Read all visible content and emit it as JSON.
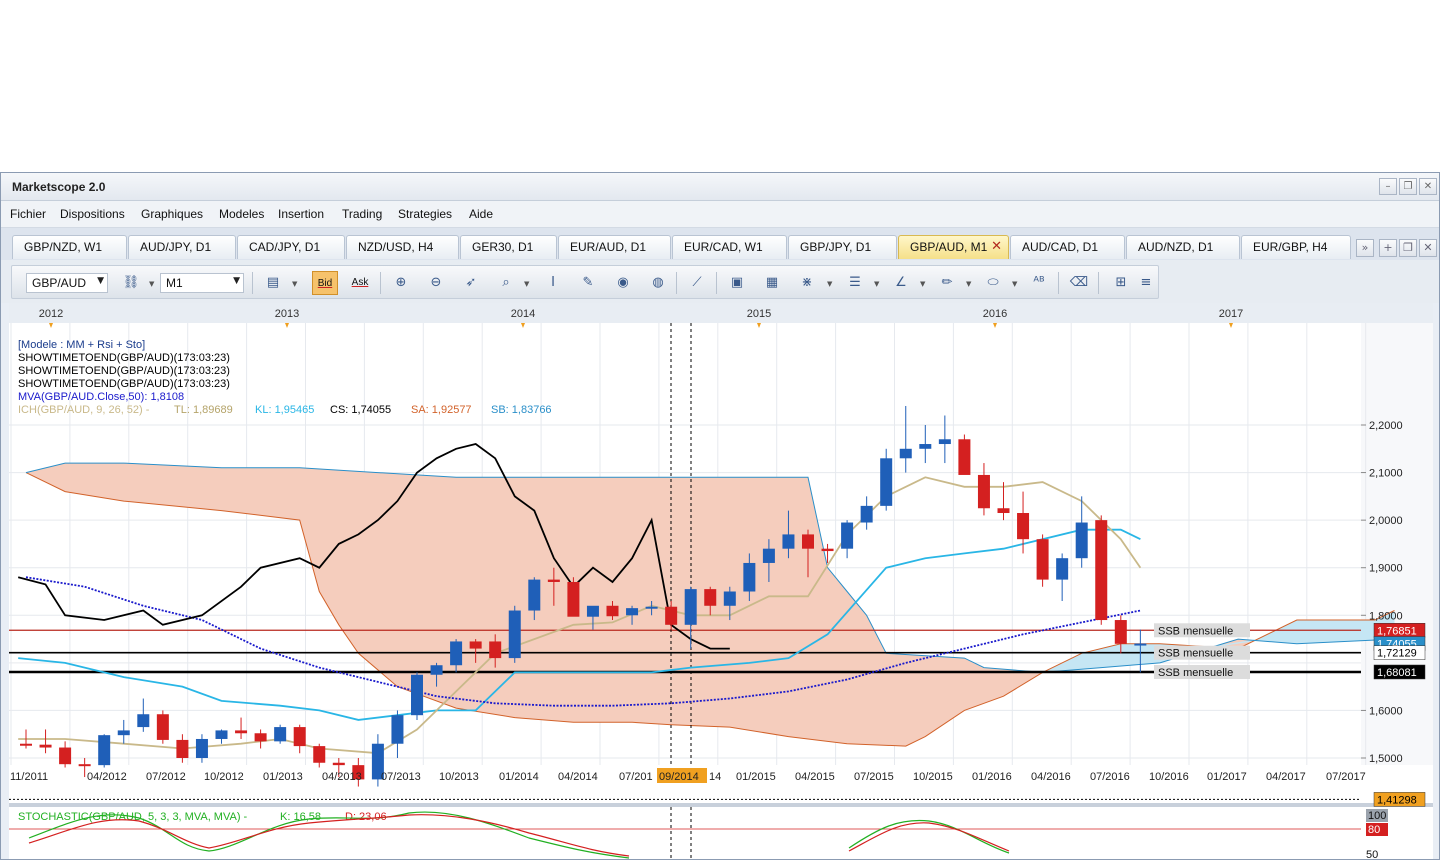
{
  "window": {
    "title": "Marketscope 2.0",
    "controls": [
      "–",
      "❐",
      "✕"
    ]
  },
  "menu": [
    "Fichier",
    "Dispositions",
    "Graphiques",
    "Modeles",
    "Insertion",
    "Trading",
    "Strategies",
    "Aide"
  ],
  "tabs": [
    {
      "label": "GBP/NZD, W1",
      "active": false
    },
    {
      "label": "AUD/JPY, D1",
      "active": false
    },
    {
      "label": "CAD/JPY, D1",
      "active": false
    },
    {
      "label": "NZD/USD, H4",
      "active": false
    },
    {
      "label": "GER30, D1",
      "active": false
    },
    {
      "label": "EUR/AUD, D1",
      "active": false
    },
    {
      "label": "EUR/CAD, W1",
      "active": false
    },
    {
      "label": "GBP/JPY, D1",
      "active": false
    },
    {
      "label": "GBP/AUD, M1",
      "active": true
    },
    {
      "label": "AUD/CAD, D1",
      "active": false
    },
    {
      "label": "AUD/NZD, D1",
      "active": false
    },
    {
      "label": "EUR/GBP, H4",
      "active": false
    }
  ],
  "tab_close_glyph": "✕",
  "tab_controls": [
    "»",
    "+",
    "❐",
    "✕"
  ],
  "toolbar": {
    "instrument": "GBP/AUD",
    "timeframe": "M1",
    "bid_label": "Bid",
    "ask_label": "Ask",
    "icons": [
      "link-icon",
      "chart-type-icon",
      "zoom-in-icon",
      "zoom-out-icon",
      "cursor-icon",
      "data-window-icon",
      "indicator-icon",
      "template-icon",
      "eye-icon",
      "globe-icon",
      "ruler-icon",
      "picture-icon",
      "window-icon",
      "fibonacci-icon",
      "lines-icon",
      "trendline-icon",
      "pencil-icon",
      "ellipse-icon",
      "text-icon",
      "eraser-icon",
      "tree-icon",
      "more-icon"
    ]
  },
  "chart_data": {
    "type": "candlestick",
    "title": "",
    "top_years": [
      "2012",
      "2013",
      "2014",
      "2015",
      "2016",
      "2017"
    ],
    "x_labels": [
      "11/2011",
      "04/2012",
      "07/2012",
      "10/2012",
      "01/2013",
      "04/2013",
      "07/2013",
      "10/2013",
      "01/2014",
      "04/2014",
      "07/201",
      "09/2014",
      "14",
      "01/2015",
      "04/2015",
      "07/2015",
      "10/2015",
      "01/2016",
      "04/2016",
      "07/2016",
      "10/2016",
      "01/2017",
      "04/2017",
      "07/2017"
    ],
    "cursor_x_label": "09/2014",
    "y_ticks": [
      "2,2000",
      "2,1000",
      "2,0000",
      "1,9000",
      "1,8000",
      "1,6000",
      "1,5000"
    ],
    "ylim": [
      1.41,
      2.32
    ],
    "legend_lines": [
      {
        "text": "[Modele : MM + Rsi + Sto]",
        "color": "#1a3c8c"
      },
      {
        "text": "SHOWTIMETOEND(GBP/AUD)(173:03:23)",
        "color": "#000000"
      },
      {
        "text": "SHOWTIMETOEND(GBP/AUD)(173:03:23)",
        "color": "#000000"
      },
      {
        "text": "SHOWTIMETOEND(GBP/AUD)(173:03:23)",
        "color": "#000000"
      },
      {
        "text": "MVA(GBP/AUD.Close,50): 1,8108",
        "color": "#1a1acc"
      }
    ],
    "ichimoku_legend": [
      {
        "text": "ICH(GBP/AUD, 9, 26, 52) -",
        "color": "#c9b98a"
      },
      {
        "text": "TL: 1,89689",
        "color": "#b5a46a"
      },
      {
        "text": "KL: 1,95465",
        "color": "#29b6e6"
      },
      {
        "text": "CS: 1,74055",
        "color": "#000000"
      },
      {
        "text": "SA: 1,92577",
        "color": "#d2622a"
      },
      {
        "text": "SB: 1,83766",
        "color": "#2a8fc9"
      }
    ],
    "price_labels": [
      {
        "text": "1,76851",
        "value": 1.7685,
        "bg": "#d42020",
        "fg": "#ffffff"
      },
      {
        "text": "1,74055",
        "value": 1.7406,
        "bg": "#2a8fc9",
        "fg": "#ffffff"
      },
      {
        "text": "1,72129",
        "value": 1.7213,
        "bg": "#ffffff",
        "fg": "#000000"
      },
      {
        "text": "1,68081",
        "value": 1.6808,
        "bg": "#000000",
        "fg": "#ffffff"
      },
      {
        "text": "1,41298",
        "value": 1.413,
        "bg": "#f0a020",
        "fg": "#000000"
      }
    ],
    "ssb_labels": [
      {
        "text": "SSB mensuelle",
        "value": 1.7685
      },
      {
        "text": "SSB mensuelle",
        "value": 1.7213
      },
      {
        "text": "SSB mensuelle",
        "value": 1.6808
      }
    ],
    "candles": [
      {
        "o": 1.53,
        "h": 1.56,
        "l": 1.52,
        "c": 1.528
      },
      {
        "o": 1.528,
        "h": 1.56,
        "l": 1.51,
        "c": 1.522
      },
      {
        "o": 1.522,
        "h": 1.535,
        "l": 1.48,
        "c": 1.487
      },
      {
        "o": 1.487,
        "h": 1.5,
        "l": 1.46,
        "c": 1.484
      },
      {
        "o": 1.485,
        "h": 1.55,
        "l": 1.48,
        "c": 1.548
      },
      {
        "o": 1.548,
        "h": 1.58,
        "l": 1.53,
        "c": 1.558
      },
      {
        "o": 1.565,
        "h": 1.625,
        "l": 1.555,
        "c": 1.592
      },
      {
        "o": 1.592,
        "h": 1.6,
        "l": 1.53,
        "c": 1.538
      },
      {
        "o": 1.538,
        "h": 1.55,
        "l": 1.49,
        "c": 1.5
      },
      {
        "o": 1.5,
        "h": 1.55,
        "l": 1.49,
        "c": 1.54
      },
      {
        "o": 1.54,
        "h": 1.56,
        "l": 1.53,
        "c": 1.558
      },
      {
        "o": 1.558,
        "h": 1.585,
        "l": 1.54,
        "c": 1.552
      },
      {
        "o": 1.552,
        "h": 1.56,
        "l": 1.52,
        "c": 1.535
      },
      {
        "o": 1.535,
        "h": 1.57,
        "l": 1.53,
        "c": 1.565
      },
      {
        "o": 1.565,
        "h": 1.57,
        "l": 1.51,
        "c": 1.525
      },
      {
        "o": 1.525,
        "h": 1.53,
        "l": 1.48,
        "c": 1.49
      },
      {
        "o": 1.49,
        "h": 1.5,
        "l": 1.46,
        "c": 1.485
      },
      {
        "o": 1.485,
        "h": 1.5,
        "l": 1.44,
        "c": 1.455
      },
      {
        "o": 1.455,
        "h": 1.55,
        "l": 1.44,
        "c": 1.53
      },
      {
        "o": 1.53,
        "h": 1.6,
        "l": 1.5,
        "c": 1.59
      },
      {
        "o": 1.59,
        "h": 1.68,
        "l": 1.58,
        "c": 1.675
      },
      {
        "o": 1.675,
        "h": 1.7,
        "l": 1.65,
        "c": 1.695
      },
      {
        "o": 1.695,
        "h": 1.75,
        "l": 1.68,
        "c": 1.745
      },
      {
        "o": 1.745,
        "h": 1.75,
        "l": 1.7,
        "c": 1.73
      },
      {
        "o": 1.745,
        "h": 1.76,
        "l": 1.69,
        "c": 1.71
      },
      {
        "o": 1.71,
        "h": 1.82,
        "l": 1.7,
        "c": 1.81
      },
      {
        "o": 1.81,
        "h": 1.88,
        "l": 1.79,
        "c": 1.875
      },
      {
        "o": 1.875,
        "h": 1.9,
        "l": 1.82,
        "c": 1.87
      },
      {
        "o": 1.87,
        "h": 1.88,
        "l": 1.8,
        "c": 1.797
      },
      {
        "o": 1.797,
        "h": 1.81,
        "l": 1.77,
        "c": 1.82
      },
      {
        "o": 1.82,
        "h": 1.83,
        "l": 1.79,
        "c": 1.798
      },
      {
        "o": 1.8,
        "h": 1.82,
        "l": 1.78,
        "c": 1.815
      },
      {
        "o": 1.815,
        "h": 1.83,
        "l": 1.8,
        "c": 1.818
      },
      {
        "o": 1.818,
        "h": 1.83,
        "l": 1.77,
        "c": 1.78
      },
      {
        "o": 1.78,
        "h": 1.86,
        "l": 1.73,
        "c": 1.855
      },
      {
        "o": 1.855,
        "h": 1.86,
        "l": 1.8,
        "c": 1.82
      },
      {
        "o": 1.82,
        "h": 1.86,
        "l": 1.79,
        "c": 1.85
      },
      {
        "o": 1.85,
        "h": 1.93,
        "l": 1.83,
        "c": 1.91
      },
      {
        "o": 1.91,
        "h": 1.96,
        "l": 1.87,
        "c": 1.94
      },
      {
        "o": 1.94,
        "h": 2.02,
        "l": 1.92,
        "c": 1.97
      },
      {
        "o": 1.97,
        "h": 1.98,
        "l": 1.88,
        "c": 1.94
      },
      {
        "o": 1.94,
        "h": 1.95,
        "l": 1.91,
        "c": 1.935
      },
      {
        "o": 1.94,
        "h": 2.0,
        "l": 1.92,
        "c": 1.995
      },
      {
        "o": 1.995,
        "h": 2.05,
        "l": 1.98,
        "c": 2.03
      },
      {
        "o": 2.03,
        "h": 2.15,
        "l": 2.02,
        "c": 2.13
      },
      {
        "o": 2.13,
        "h": 2.24,
        "l": 2.1,
        "c": 2.15
      },
      {
        "o": 2.15,
        "h": 2.2,
        "l": 2.12,
        "c": 2.16
      },
      {
        "o": 2.16,
        "h": 2.22,
        "l": 2.12,
        "c": 2.17
      },
      {
        "o": 2.17,
        "h": 2.18,
        "l": 2.1,
        "c": 2.095
      },
      {
        "o": 2.095,
        "h": 2.12,
        "l": 2.01,
        "c": 2.025
      },
      {
        "o": 2.025,
        "h": 2.08,
        "l": 2.0,
        "c": 2.015
      },
      {
        "o": 2.015,
        "h": 2.06,
        "l": 1.93,
        "c": 1.96
      },
      {
        "o": 1.96,
        "h": 1.97,
        "l": 1.86,
        "c": 1.875
      },
      {
        "o": 1.875,
        "h": 1.93,
        "l": 1.83,
        "c": 1.92
      },
      {
        "o": 1.92,
        "h": 2.05,
        "l": 1.9,
        "c": 1.995
      },
      {
        "o": 2.0,
        "h": 2.01,
        "l": 1.78,
        "c": 1.79
      },
      {
        "o": 1.79,
        "h": 1.8,
        "l": 1.72,
        "c": 1.74
      },
      {
        "o": 1.74,
        "h": 1.77,
        "l": 1.68,
        "c": 1.7406
      }
    ],
    "mva50": [
      [
        0,
        1.88
      ],
      [
        3,
        1.86
      ],
      [
        6,
        1.82
      ],
      [
        9,
        1.79
      ],
      [
        12,
        1.73
      ],
      [
        15,
        1.69
      ],
      [
        18,
        1.66
      ],
      [
        21,
        1.63
      ],
      [
        24,
        1.615
      ],
      [
        27,
        1.61
      ],
      [
        30,
        1.61
      ],
      [
        33,
        1.615
      ],
      [
        36,
        1.625
      ],
      [
        39,
        1.64
      ],
      [
        42,
        1.665
      ],
      [
        45,
        1.7
      ],
      [
        48,
        1.73
      ],
      [
        51,
        1.76
      ],
      [
        54,
        1.785
      ],
      [
        57,
        1.81
      ]
    ],
    "chikou": [
      [
        -0.4,
        1.88
      ],
      [
        1,
        1.865
      ],
      [
        2,
        1.8
      ],
      [
        4,
        1.79
      ],
      [
        6,
        1.81
      ],
      [
        7,
        1.78
      ],
      [
        9,
        1.8
      ],
      [
        11,
        1.86
      ],
      [
        12,
        1.9
      ],
      [
        14,
        1.92
      ],
      [
        15,
        1.9
      ],
      [
        16,
        1.95
      ],
      [
        17,
        1.97
      ],
      [
        18,
        2.0
      ],
      [
        19,
        2.04
      ],
      [
        20,
        2.1
      ],
      [
        21,
        2.13
      ],
      [
        22,
        2.15
      ],
      [
        23,
        2.16
      ],
      [
        24,
        2.13
      ],
      [
        25,
        2.05
      ],
      [
        26,
        2.02
      ],
      [
        27,
        1.92
      ],
      [
        28,
        1.86
      ],
      [
        29,
        1.9
      ],
      [
        30,
        1.87
      ],
      [
        31,
        1.92
      ],
      [
        32,
        2.0
      ],
      [
        33,
        1.78
      ],
      [
        34,
        1.75
      ],
      [
        35,
        1.73
      ],
      [
        36,
        1.73
      ]
    ],
    "senkou_a": [
      [
        0,
        2.1
      ],
      [
        2,
        2.06
      ],
      [
        5,
        2.04
      ],
      [
        10,
        2.02
      ],
      [
        14,
        2.0
      ],
      [
        15,
        1.85
      ],
      [
        16,
        1.78
      ],
      [
        17,
        1.72
      ],
      [
        19,
        1.65
      ],
      [
        22,
        1.605
      ],
      [
        25,
        1.585
      ],
      [
        28,
        1.575
      ],
      [
        31,
        1.575
      ],
      [
        33,
        1.57
      ],
      [
        36,
        1.565
      ],
      [
        39,
        1.545
      ],
      [
        42,
        1.53
      ],
      [
        45,
        1.525
      ],
      [
        46,
        1.545
      ],
      [
        48,
        1.6
      ],
      [
        50,
        1.63
      ],
      [
        52,
        1.68
      ],
      [
        54,
        1.72
      ],
      [
        56,
        1.74
      ],
      [
        58,
        1.74
      ],
      [
        62,
        1.73
      ],
      [
        65,
        1.79
      ],
      [
        69,
        1.79
      ],
      [
        70,
        1.81
      ]
    ],
    "senkou_b": [
      [
        0,
        2.1
      ],
      [
        2,
        2.12
      ],
      [
        5,
        2.12
      ],
      [
        10,
        2.11
      ],
      [
        14,
        2.11
      ],
      [
        18,
        2.1
      ],
      [
        22,
        2.09
      ],
      [
        26,
        2.09
      ],
      [
        30,
        2.09
      ],
      [
        34,
        2.09
      ],
      [
        38,
        2.09
      ],
      [
        40,
        2.09
      ],
      [
        41,
        1.9
      ],
      [
        42,
        1.85
      ],
      [
        43,
        1.8
      ],
      [
        44,
        1.72
      ],
      [
        48,
        1.71
      ],
      [
        49,
        1.69
      ],
      [
        52,
        1.68
      ],
      [
        55,
        1.69
      ],
      [
        58,
        1.7
      ],
      [
        62,
        1.75
      ],
      [
        65,
        1.74
      ],
      [
        70,
        1.75
      ]
    ],
    "kijun": [
      [
        -0.4,
        1.71
      ],
      [
        2,
        1.7
      ],
      [
        5,
        1.67
      ],
      [
        8,
        1.65
      ],
      [
        10,
        1.62
      ],
      [
        13,
        1.61
      ],
      [
        15,
        1.6
      ],
      [
        17,
        1.58
      ],
      [
        19,
        1.59
      ],
      [
        21,
        1.6
      ],
      [
        23,
        1.6
      ],
      [
        25,
        1.68
      ],
      [
        28,
        1.68
      ],
      [
        30,
        1.68
      ],
      [
        32,
        1.68
      ],
      [
        34,
        1.69
      ],
      [
        37,
        1.7
      ],
      [
        39,
        1.71
      ],
      [
        41,
        1.76
      ],
      [
        44,
        1.9
      ],
      [
        46,
        1.92
      ],
      [
        48,
        1.93
      ],
      [
        50,
        1.94
      ],
      [
        54,
        1.98
      ],
      [
        56,
        1.98
      ],
      [
        57,
        1.96
      ]
    ],
    "tenkan": [
      [
        -0.4,
        1.54
      ],
      [
        2,
        1.54
      ],
      [
        5,
        1.53
      ],
      [
        8,
        1.52
      ],
      [
        11,
        1.53
      ],
      [
        13,
        1.54
      ],
      [
        15,
        1.52
      ],
      [
        18,
        1.51
      ],
      [
        20,
        1.56
      ],
      [
        22,
        1.64
      ],
      [
        24,
        1.72
      ],
      [
        26,
        1.75
      ],
      [
        28,
        1.78
      ],
      [
        30,
        1.785
      ],
      [
        32,
        1.82
      ],
      [
        34,
        1.8
      ],
      [
        36,
        1.8
      ],
      [
        38,
        1.84
      ],
      [
        40,
        1.84
      ],
      [
        42,
        1.97
      ],
      [
        44,
        2.05
      ],
      [
        46,
        2.09
      ],
      [
        48,
        2.07
      ],
      [
        50,
        2.07
      ],
      [
        52,
        2.08
      ],
      [
        54,
        2.04
      ],
      [
        56,
        1.96
      ],
      [
        57,
        1.9
      ]
    ],
    "stochastic": {
      "legend": "STOCHASTIC(GBP/AUD, 5, 3, 3, MVA, MVA) -",
      "k_label": "K: 16,58",
      "d_label": "D: 23,06",
      "levels": [
        "100",
        "80",
        "50"
      ]
    }
  },
  "colors": {
    "bull": "#1f5fb8",
    "bear": "#d42020",
    "cloud_bear": "#f5cdbd",
    "cloud_bull": "#c5e6f4",
    "accent": "#f0a020"
  }
}
